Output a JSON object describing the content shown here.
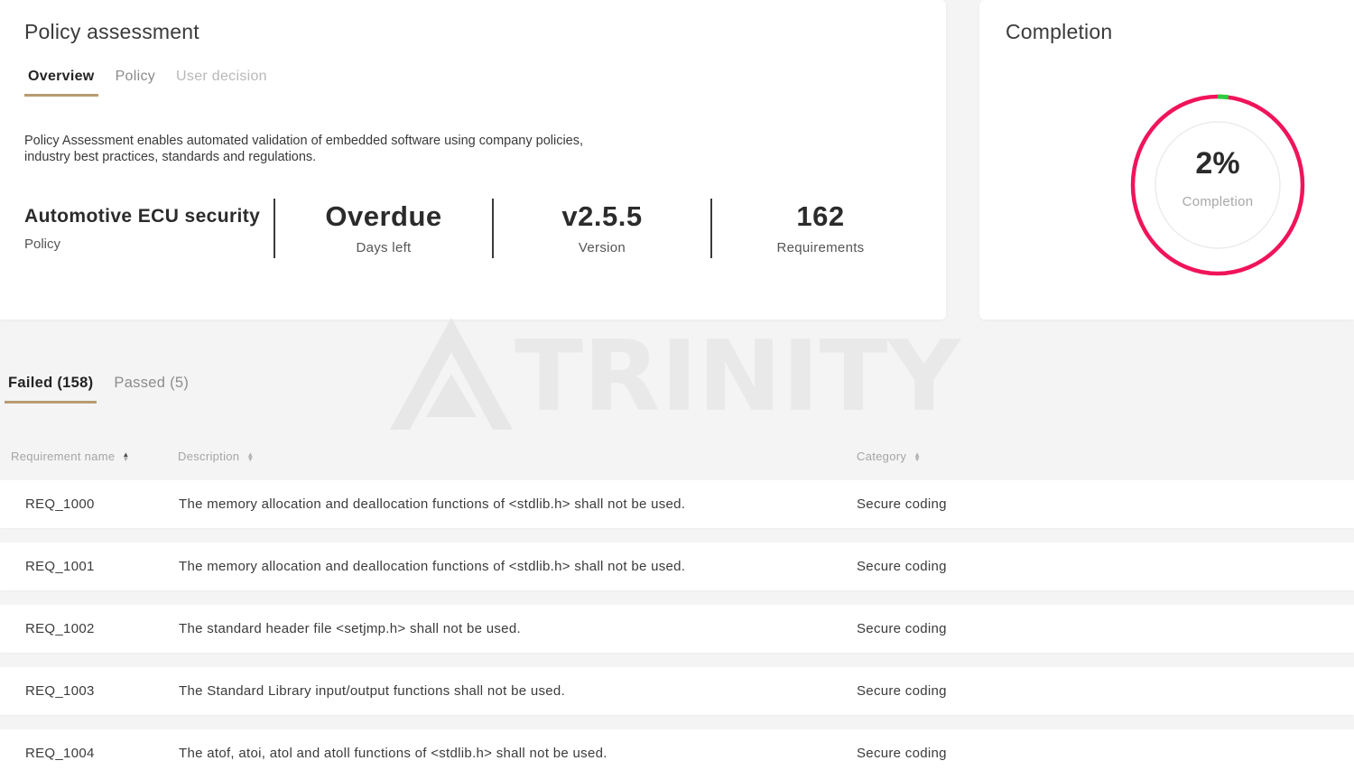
{
  "assessment": {
    "title": "Policy assessment",
    "tabs": [
      {
        "label": "Overview",
        "state": "active"
      },
      {
        "label": "Policy",
        "state": "inactive"
      },
      {
        "label": "User decision",
        "state": "muted"
      }
    ],
    "description": "Policy Assessment enables automated validation of embedded software using company policies, industry best practices, standards and regulations.",
    "stats": [
      {
        "value": "Automotive ECU security",
        "label": "Policy"
      },
      {
        "value": "Overdue",
        "label": "Days left"
      },
      {
        "value": "v2.5.5",
        "label": "Version"
      },
      {
        "value": "162",
        "label": "Requirements"
      }
    ]
  },
  "completion": {
    "title": "Completion",
    "value": "2%",
    "fraction": 0.02,
    "label": "Completion",
    "ring_color": "#f0145a",
    "progress_color": "#2ecc40"
  },
  "watermark": {
    "text": "TRINITY",
    "icon": "triangle-logo-icon"
  },
  "results_tabs": [
    {
      "label": "Failed (158)",
      "state": "active"
    },
    {
      "label": "Passed (5)",
      "state": "inactive"
    }
  ],
  "table": {
    "columns": [
      "Requirement name",
      "Description",
      "Category"
    ],
    "rows": [
      {
        "name": "REQ_1000",
        "description": "The memory allocation and deallocation functions of <stdlib.h> shall not be used.",
        "category": "Secure coding"
      },
      {
        "name": "REQ_1001",
        "description": "The memory allocation and deallocation functions of <stdlib.h> shall not be used.",
        "category": "Secure coding"
      },
      {
        "name": "REQ_1002",
        "description": "The standard header file <setjmp.h> shall not be used.",
        "category": "Secure coding"
      },
      {
        "name": "REQ_1003",
        "description": "The Standard Library input/output functions shall not be used.",
        "category": "Secure coding"
      },
      {
        "name": "REQ_1004",
        "description": "The atof, atoi, atol and atoll functions of <stdlib.h> shall not be used.",
        "category": "Secure coding"
      }
    ]
  },
  "colors": {
    "accent_underline": "#b89b72",
    "background": "#f4f4f4"
  }
}
